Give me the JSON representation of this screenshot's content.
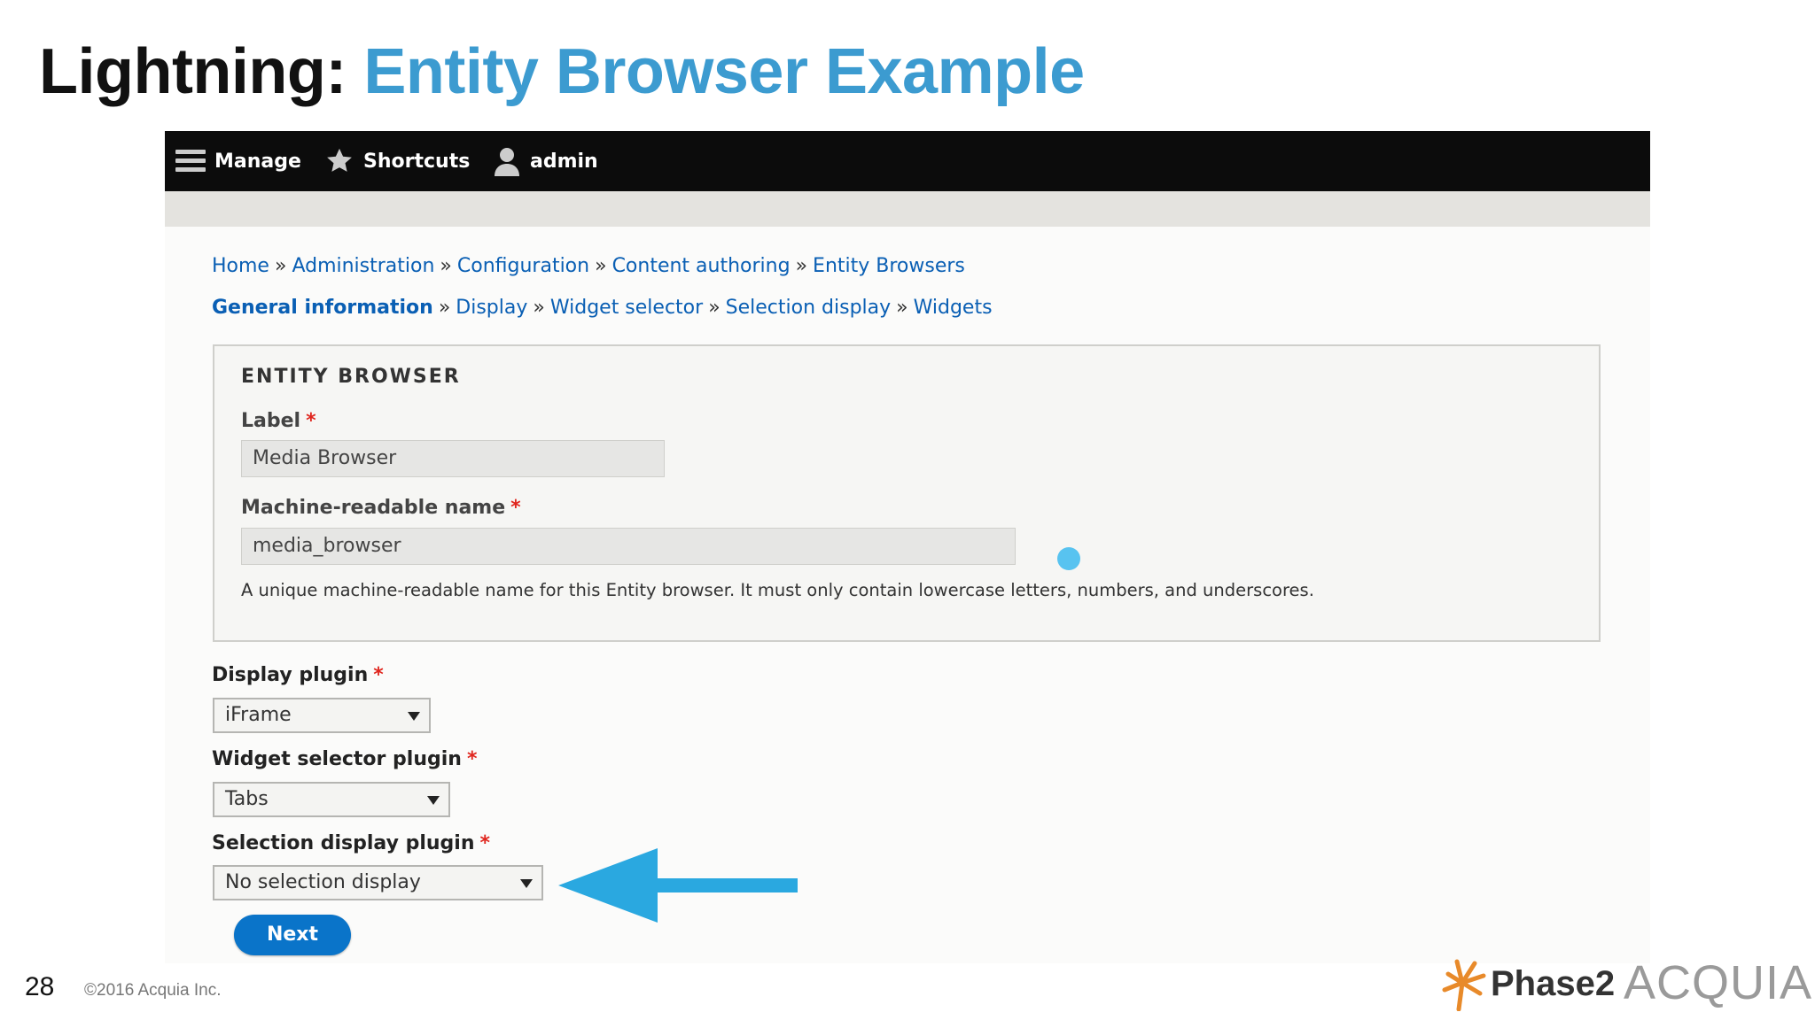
{
  "slide": {
    "title_prefix": "Lightning:",
    "title_main": "Entity Browser Example",
    "page_number": "28",
    "copyright": "©2016 Acquia Inc.",
    "logos": {
      "phase2": "Phase2",
      "acquia": "ACQUIA"
    }
  },
  "toolbar": {
    "items": [
      {
        "label": "Manage",
        "icon": "hamburger-icon"
      },
      {
        "label": "Shortcuts",
        "icon": "star-icon"
      },
      {
        "label": "admin",
        "icon": "user-icon"
      }
    ]
  },
  "breadcrumb": [
    "Home",
    "Administration",
    "Configuration",
    "Content authoring",
    "Entity Browsers"
  ],
  "breadcrumb_separator": "»",
  "wizard_steps": [
    {
      "label": "General information",
      "active": true
    },
    {
      "label": "Display",
      "active": false
    },
    {
      "label": "Widget selector",
      "active": false
    },
    {
      "label": "Selection display",
      "active": false
    },
    {
      "label": "Widgets",
      "active": false
    }
  ],
  "entity_browser": {
    "legend": "ENTITY BROWSER",
    "label_field": {
      "label": "Label",
      "required_marker": "*",
      "value": "Media Browser"
    },
    "machine_name_field": {
      "label": "Machine-readable name",
      "required_marker": "*",
      "value": "media_browser"
    },
    "description": "A unique machine-readable name for this Entity browser. It must only contain lowercase letters, numbers, and underscores."
  },
  "form": {
    "display_plugin": {
      "label": "Display plugin",
      "required_marker": "*",
      "value": "iFrame"
    },
    "widget_selector_plugin": {
      "label": "Widget selector plugin",
      "required_marker": "*",
      "value": "Tabs"
    },
    "selection_display_plugin": {
      "label": "Selection display plugin",
      "required_marker": "*",
      "value": "No selection display"
    },
    "next_label": "Next"
  },
  "colors": {
    "title_accent": "#3c9bd0",
    "link": "#0a5fb4",
    "button": "#0a74c9",
    "arrow": "#2aa8e0",
    "required": "#e0261e"
  }
}
